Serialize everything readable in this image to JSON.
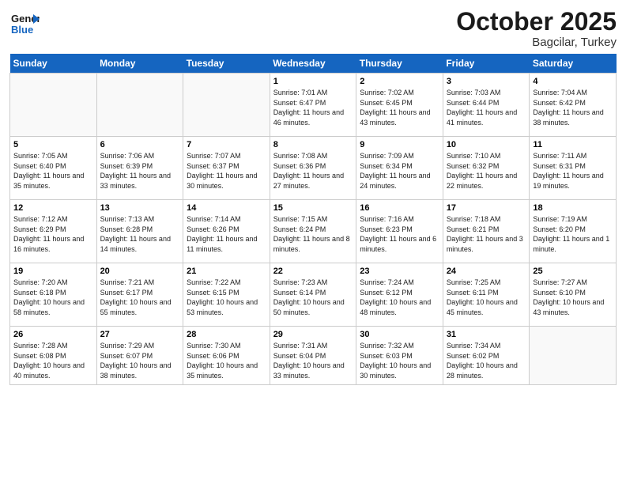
{
  "header": {
    "logo_general": "General",
    "logo_blue": "Blue",
    "month": "October 2025",
    "location": "Bagcilar, Turkey"
  },
  "days_of_week": [
    "Sunday",
    "Monday",
    "Tuesday",
    "Wednesday",
    "Thursday",
    "Friday",
    "Saturday"
  ],
  "weeks": [
    [
      {
        "num": "",
        "sunrise": "",
        "sunset": "",
        "daylight": ""
      },
      {
        "num": "",
        "sunrise": "",
        "sunset": "",
        "daylight": ""
      },
      {
        "num": "",
        "sunrise": "",
        "sunset": "",
        "daylight": ""
      },
      {
        "num": "1",
        "sunrise": "Sunrise: 7:01 AM",
        "sunset": "Sunset: 6:47 PM",
        "daylight": "Daylight: 11 hours and 46 minutes."
      },
      {
        "num": "2",
        "sunrise": "Sunrise: 7:02 AM",
        "sunset": "Sunset: 6:45 PM",
        "daylight": "Daylight: 11 hours and 43 minutes."
      },
      {
        "num": "3",
        "sunrise": "Sunrise: 7:03 AM",
        "sunset": "Sunset: 6:44 PM",
        "daylight": "Daylight: 11 hours and 41 minutes."
      },
      {
        "num": "4",
        "sunrise": "Sunrise: 7:04 AM",
        "sunset": "Sunset: 6:42 PM",
        "daylight": "Daylight: 11 hours and 38 minutes."
      }
    ],
    [
      {
        "num": "5",
        "sunrise": "Sunrise: 7:05 AM",
        "sunset": "Sunset: 6:40 PM",
        "daylight": "Daylight: 11 hours and 35 minutes."
      },
      {
        "num": "6",
        "sunrise": "Sunrise: 7:06 AM",
        "sunset": "Sunset: 6:39 PM",
        "daylight": "Daylight: 11 hours and 33 minutes."
      },
      {
        "num": "7",
        "sunrise": "Sunrise: 7:07 AM",
        "sunset": "Sunset: 6:37 PM",
        "daylight": "Daylight: 11 hours and 30 minutes."
      },
      {
        "num": "8",
        "sunrise": "Sunrise: 7:08 AM",
        "sunset": "Sunset: 6:36 PM",
        "daylight": "Daylight: 11 hours and 27 minutes."
      },
      {
        "num": "9",
        "sunrise": "Sunrise: 7:09 AM",
        "sunset": "Sunset: 6:34 PM",
        "daylight": "Daylight: 11 hours and 24 minutes."
      },
      {
        "num": "10",
        "sunrise": "Sunrise: 7:10 AM",
        "sunset": "Sunset: 6:32 PM",
        "daylight": "Daylight: 11 hours and 22 minutes."
      },
      {
        "num": "11",
        "sunrise": "Sunrise: 7:11 AM",
        "sunset": "Sunset: 6:31 PM",
        "daylight": "Daylight: 11 hours and 19 minutes."
      }
    ],
    [
      {
        "num": "12",
        "sunrise": "Sunrise: 7:12 AM",
        "sunset": "Sunset: 6:29 PM",
        "daylight": "Daylight: 11 hours and 16 minutes."
      },
      {
        "num": "13",
        "sunrise": "Sunrise: 7:13 AM",
        "sunset": "Sunset: 6:28 PM",
        "daylight": "Daylight: 11 hours and 14 minutes."
      },
      {
        "num": "14",
        "sunrise": "Sunrise: 7:14 AM",
        "sunset": "Sunset: 6:26 PM",
        "daylight": "Daylight: 11 hours and 11 minutes."
      },
      {
        "num": "15",
        "sunrise": "Sunrise: 7:15 AM",
        "sunset": "Sunset: 6:24 PM",
        "daylight": "Daylight: 11 hours and 8 minutes."
      },
      {
        "num": "16",
        "sunrise": "Sunrise: 7:16 AM",
        "sunset": "Sunset: 6:23 PM",
        "daylight": "Daylight: 11 hours and 6 minutes."
      },
      {
        "num": "17",
        "sunrise": "Sunrise: 7:18 AM",
        "sunset": "Sunset: 6:21 PM",
        "daylight": "Daylight: 11 hours and 3 minutes."
      },
      {
        "num": "18",
        "sunrise": "Sunrise: 7:19 AM",
        "sunset": "Sunset: 6:20 PM",
        "daylight": "Daylight: 11 hours and 1 minute."
      }
    ],
    [
      {
        "num": "19",
        "sunrise": "Sunrise: 7:20 AM",
        "sunset": "Sunset: 6:18 PM",
        "daylight": "Daylight: 10 hours and 58 minutes."
      },
      {
        "num": "20",
        "sunrise": "Sunrise: 7:21 AM",
        "sunset": "Sunset: 6:17 PM",
        "daylight": "Daylight: 10 hours and 55 minutes."
      },
      {
        "num": "21",
        "sunrise": "Sunrise: 7:22 AM",
        "sunset": "Sunset: 6:15 PM",
        "daylight": "Daylight: 10 hours and 53 minutes."
      },
      {
        "num": "22",
        "sunrise": "Sunrise: 7:23 AM",
        "sunset": "Sunset: 6:14 PM",
        "daylight": "Daylight: 10 hours and 50 minutes."
      },
      {
        "num": "23",
        "sunrise": "Sunrise: 7:24 AM",
        "sunset": "Sunset: 6:12 PM",
        "daylight": "Daylight: 10 hours and 48 minutes."
      },
      {
        "num": "24",
        "sunrise": "Sunrise: 7:25 AM",
        "sunset": "Sunset: 6:11 PM",
        "daylight": "Daylight: 10 hours and 45 minutes."
      },
      {
        "num": "25",
        "sunrise": "Sunrise: 7:27 AM",
        "sunset": "Sunset: 6:10 PM",
        "daylight": "Daylight: 10 hours and 43 minutes."
      }
    ],
    [
      {
        "num": "26",
        "sunrise": "Sunrise: 7:28 AM",
        "sunset": "Sunset: 6:08 PM",
        "daylight": "Daylight: 10 hours and 40 minutes."
      },
      {
        "num": "27",
        "sunrise": "Sunrise: 7:29 AM",
        "sunset": "Sunset: 6:07 PM",
        "daylight": "Daylight: 10 hours and 38 minutes."
      },
      {
        "num": "28",
        "sunrise": "Sunrise: 7:30 AM",
        "sunset": "Sunset: 6:06 PM",
        "daylight": "Daylight: 10 hours and 35 minutes."
      },
      {
        "num": "29",
        "sunrise": "Sunrise: 7:31 AM",
        "sunset": "Sunset: 6:04 PM",
        "daylight": "Daylight: 10 hours and 33 minutes."
      },
      {
        "num": "30",
        "sunrise": "Sunrise: 7:32 AM",
        "sunset": "Sunset: 6:03 PM",
        "daylight": "Daylight: 10 hours and 30 minutes."
      },
      {
        "num": "31",
        "sunrise": "Sunrise: 7:34 AM",
        "sunset": "Sunset: 6:02 PM",
        "daylight": "Daylight: 10 hours and 28 minutes."
      },
      {
        "num": "",
        "sunrise": "",
        "sunset": "",
        "daylight": ""
      }
    ]
  ]
}
